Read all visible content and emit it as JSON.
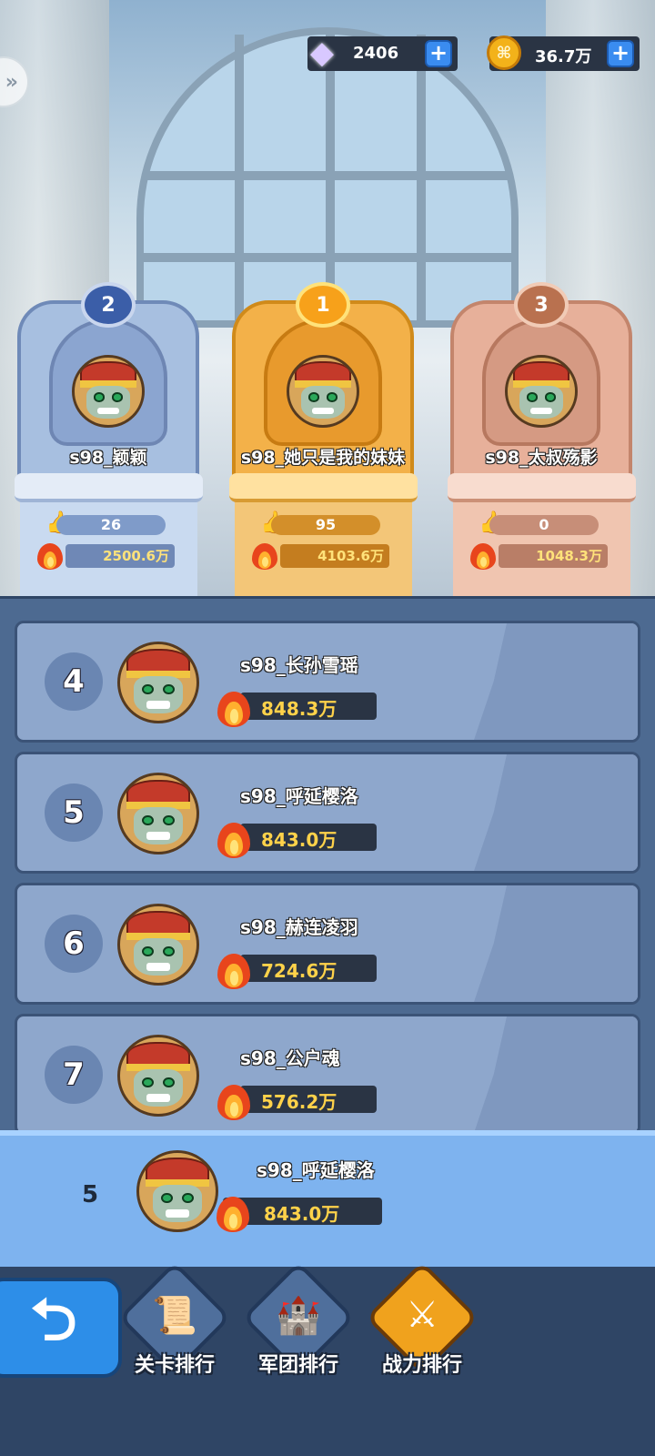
{
  "currency": {
    "gems": "2406",
    "gold": "36.7万",
    "gem_icon": "diamond-icon",
    "gold_icon": "gold-coin-icon",
    "gold_coin_glyph": "⌘"
  },
  "top3": [
    {
      "rank": "2",
      "name": "s98_颖颖",
      "likes": "26",
      "power": "2500.6万"
    },
    {
      "rank": "1",
      "name": "s98_她只是我的妹妹",
      "likes": "95",
      "power": "4103.6万"
    },
    {
      "rank": "3",
      "name": "s98_太叔殇影",
      "likes": "0",
      "power": "1048.3万"
    }
  ],
  "list": [
    {
      "rank": "4",
      "name": "s98_长孙雪瑶",
      "power": "848.3万"
    },
    {
      "rank": "5",
      "name": "s98_呼延樱洛",
      "power": "843.0万"
    },
    {
      "rank": "6",
      "name": "s98_赫连凌羽",
      "power": "724.6万"
    },
    {
      "rank": "7",
      "name": "s98_公户魂",
      "power": "576.2万"
    }
  ],
  "my_rank": {
    "rank": "5",
    "name": "s98_呼延樱洛",
    "power": "843.0万"
  },
  "nav": {
    "back_icon": "back-arrow-icon",
    "tabs": [
      {
        "label": "关卡排行",
        "icon": "stage-scroll-icon",
        "active": false
      },
      {
        "label": "军团排行",
        "icon": "legion-cannon-icon",
        "active": false
      },
      {
        "label": "战力排行",
        "icon": "crossed-swords-icon",
        "active": true
      }
    ]
  },
  "colors": {
    "gold_podium": "#f3b149",
    "silver_podium": "#a7bfe0",
    "bronze_podium": "#e7b09a",
    "power_text": "#ffd24a",
    "active_tab": "#f0a21d"
  }
}
